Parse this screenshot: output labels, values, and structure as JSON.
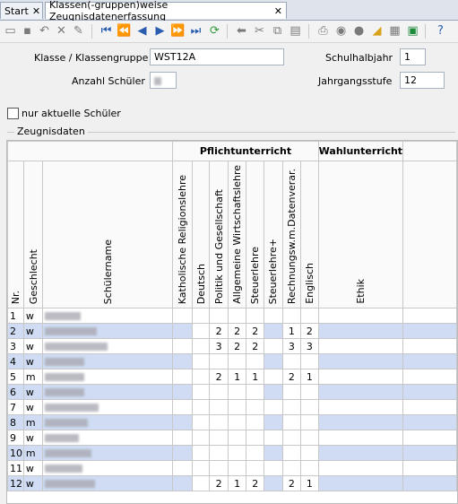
{
  "tabs": [
    {
      "label": "Start"
    },
    {
      "label": "Klassen(-gruppen)weise Zeugnisdatenerfassung"
    }
  ],
  "form": {
    "klasse_label": "Klasse / Klassengruppe",
    "klasse_value": "WST12A",
    "halbjahr_label": "Schulhalbjahr",
    "halbjahr_value": "1",
    "anzahl_label": "Anzahl Schüler",
    "jahrgang_label": "Jahrgangsstufe",
    "jahrgang_value": "12",
    "nur_aktuelle_label": "nur aktuelle Schüler",
    "group_title": "Zeugnisdaten"
  },
  "grid": {
    "group_headers": {
      "pflicht": "Pflichtunterricht",
      "wahl": "Wahlunterricht"
    },
    "columns": [
      "Nr.",
      "Geschlecht",
      "Schülername",
      "Katholische Religionslehre",
      "Deutsch",
      "Politik und Gesellschaft",
      "Allgemeine Wirtschaftslehre",
      "Steuerlehre",
      "Steuerlehre+",
      "Rechnungsw.m.Datenverar.",
      "Englisch",
      "Ethik"
    ],
    "rows": [
      {
        "nr": "1",
        "g": "w",
        "grades": [
          "",
          "",
          "",
          "",
          "",
          "",
          "",
          ""
        ]
      },
      {
        "nr": "2",
        "g": "w",
        "grades": [
          "",
          "",
          "2",
          "2",
          "2",
          "",
          "1",
          "2"
        ]
      },
      {
        "nr": "3",
        "g": "w",
        "grades": [
          "",
          "",
          "3",
          "2",
          "2",
          "",
          "3",
          "3"
        ]
      },
      {
        "nr": "4",
        "g": "w",
        "grades": [
          "",
          "",
          "",
          "",
          "",
          "",
          "",
          ""
        ]
      },
      {
        "nr": "5",
        "g": "m",
        "grades": [
          "",
          "",
          "2",
          "1",
          "1",
          "",
          "2",
          "1"
        ]
      },
      {
        "nr": "6",
        "g": "w",
        "grades": [
          "",
          "",
          "",
          "",
          "",
          "",
          "",
          ""
        ]
      },
      {
        "nr": "7",
        "g": "w",
        "grades": [
          "",
          "",
          "",
          "",
          "",
          "",
          "",
          ""
        ]
      },
      {
        "nr": "8",
        "g": "m",
        "grades": [
          "",
          "",
          "",
          "",
          "",
          "",
          "",
          ""
        ]
      },
      {
        "nr": "9",
        "g": "w",
        "grades": [
          "",
          "",
          "",
          "",
          "",
          "",
          "",
          ""
        ]
      },
      {
        "nr": "10",
        "g": "m",
        "grades": [
          "",
          "",
          "",
          "",
          "",
          "",
          "",
          ""
        ]
      },
      {
        "nr": "11",
        "g": "w",
        "grades": [
          "",
          "",
          "",
          "",
          "",
          "",
          "",
          ""
        ]
      },
      {
        "nr": "12",
        "g": "w",
        "grades": [
          "",
          "",
          "2",
          "1",
          "2",
          "",
          "2",
          "1"
        ]
      }
    ]
  },
  "toolbar_icons": [
    "new-icon",
    "save-icon",
    "undo-icon",
    "delete-icon",
    "edit-icon",
    "first-icon",
    "prev-page-icon",
    "prev-icon",
    "next-icon",
    "next-page-icon",
    "last-icon",
    "refresh-icon",
    "back-icon",
    "cut-icon",
    "copy-icon",
    "paste-icon",
    "print-icon",
    "preview-icon",
    "bulb-icon",
    "filter-icon",
    "grid-icon",
    "excel-icon",
    "help-icon"
  ]
}
